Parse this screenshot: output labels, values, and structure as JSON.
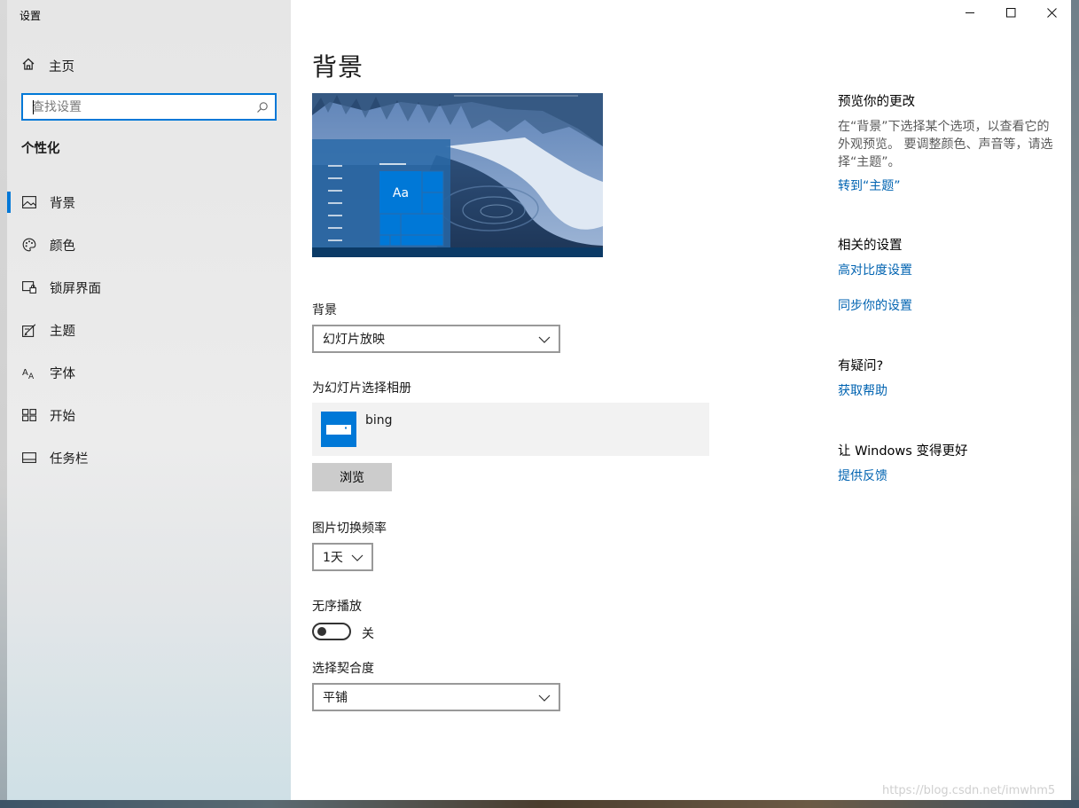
{
  "window": {
    "title": "设置",
    "controls": {
      "minimize": "minimize-icon",
      "maximize": "maximize-icon",
      "close": "close-icon"
    }
  },
  "sidebar": {
    "home_label": "主页",
    "search_placeholder": "查找设置",
    "section_title": "个性化",
    "items": [
      {
        "label": "背景",
        "icon": "picture-icon",
        "active": true
      },
      {
        "label": "颜色",
        "icon": "palette-icon",
        "active": false
      },
      {
        "label": "锁屏界面",
        "icon": "lock-screen-icon",
        "active": false
      },
      {
        "label": "主题",
        "icon": "theme-icon",
        "active": false
      },
      {
        "label": "字体",
        "icon": "font-icon",
        "active": false
      },
      {
        "label": "开始",
        "icon": "start-icon",
        "active": false
      },
      {
        "label": "任务栏",
        "icon": "taskbar-icon",
        "active": false
      }
    ]
  },
  "main": {
    "title": "背景",
    "preview": {
      "tile_text": "Aa"
    },
    "background": {
      "label": "背景",
      "value": "幻灯片放映"
    },
    "album": {
      "label": "为幻灯片选择相册",
      "name": "bing",
      "browse_label": "浏览"
    },
    "interval": {
      "label": "图片切换频率",
      "value": "1天"
    },
    "shuffle": {
      "label": "无序播放",
      "state_text": "关",
      "on": false
    },
    "fit": {
      "label": "选择契合度",
      "value": "平铺"
    }
  },
  "right": {
    "preview_heading": "预览你的更改",
    "preview_desc": "在“背景”下选择某个选项，以查看它的外观预览。 要调整颜色、声音等，请选择“主题”。",
    "go_themes": "转到“主题”",
    "related_heading": "相关的设置",
    "high_contrast": "高对比度设置",
    "sync": "同步你的设置",
    "question_heading": "有疑问?",
    "get_help": "获取帮助",
    "better_heading": "让 Windows 变得更好",
    "feedback": "提供反馈"
  },
  "watermark": "https://blog.csdn.net/imwhm5",
  "colors": {
    "accent": "#0078d7",
    "link": "#0063b1"
  }
}
